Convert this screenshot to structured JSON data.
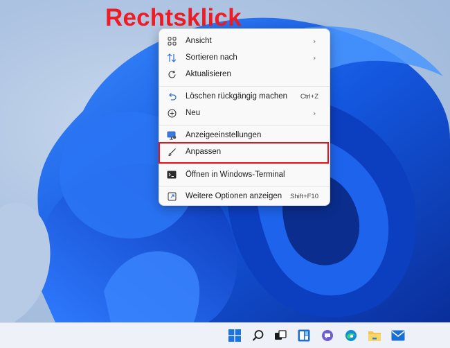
{
  "annotation": {
    "text": "Rechtsklick",
    "color": "#ee1c24"
  },
  "context_menu": {
    "items": [
      {
        "label": "Ansicht",
        "icon": "grid-view-icon",
        "shortcut": "",
        "submenu": true
      },
      {
        "label": "Sortieren nach",
        "icon": "sort-icon",
        "shortcut": "",
        "submenu": true
      },
      {
        "label": "Aktualisieren",
        "icon": "refresh-icon",
        "shortcut": "",
        "submenu": false
      },
      {
        "label": "Löschen rückgängig machen",
        "icon": "undo-icon",
        "shortcut": "Ctrl+Z",
        "submenu": false
      },
      {
        "label": "Neu",
        "icon": "plus-circle-icon",
        "shortcut": "",
        "submenu": true
      },
      {
        "label": "Anzeigeeinstellungen",
        "icon": "display-settings-icon",
        "shortcut": "",
        "submenu": false
      },
      {
        "label": "Anpassen",
        "icon": "brush-icon",
        "shortcut": "",
        "submenu": false,
        "highlighted": true
      },
      {
        "label": "Öffnen in Windows-Terminal",
        "icon": "terminal-icon",
        "shortcut": "",
        "submenu": false
      },
      {
        "label": "Weitere Optionen anzeigen",
        "icon": "more-options-icon",
        "shortcut": "Shift+F10",
        "submenu": false
      }
    ]
  },
  "taskbar": {
    "icons": [
      "start-icon",
      "search-icon",
      "task-view-icon",
      "widgets-icon",
      "teams-chat-icon",
      "edge-icon",
      "file-explorer-icon",
      "mail-icon"
    ]
  },
  "colors": {
    "accent": "#0067c0",
    "highlight_border": "#e3141b",
    "wallpaper_blue": "#1a5ee8"
  }
}
